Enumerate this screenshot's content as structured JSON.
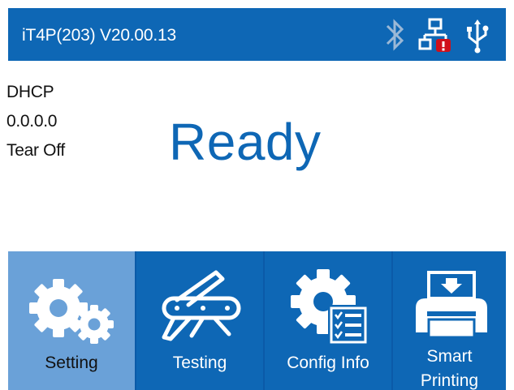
{
  "header": {
    "title": "iT4P(203) V20.00.13",
    "icons": [
      "bluetooth-icon",
      "ethernet-error-icon",
      "usb-icon"
    ]
  },
  "info": {
    "network_mode": "DHCP",
    "ip_address": "0.0.0.0",
    "print_mode": "Tear Off"
  },
  "status": {
    "text": "Ready"
  },
  "menu": {
    "items": [
      {
        "label": "Setting",
        "icon": "gears-icon",
        "selected": true
      },
      {
        "label": "Testing",
        "icon": "multitool-icon",
        "selected": false
      },
      {
        "label": "Config Info",
        "icon": "config-gear-list-icon",
        "selected": false
      },
      {
        "label_line1": "Smart",
        "label_line2": "Printing",
        "icon": "printer-icon",
        "selected": false
      }
    ]
  },
  "colors": {
    "primary": "#0e67b5",
    "selected_tile": "#6aa1d8",
    "error_badge": "#d0101a"
  }
}
